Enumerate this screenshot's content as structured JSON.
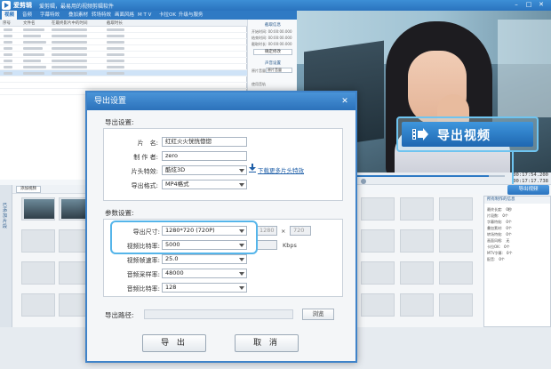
{
  "app": {
    "name": "爱剪辑",
    "subtitle": "爱剪辑，最易用的视频剪辑软件",
    "window_buttons": [
      "–",
      "□",
      "✕"
    ]
  },
  "menu": [
    "视频",
    "音频",
    "字幕特效",
    "叠加素材",
    "转场特效",
    "画面风格",
    "M T V",
    "卡拉OK",
    "升级与服务"
  ],
  "file_panel": {
    "columns": [
      "序号",
      "文件名",
      "在最终影片中的时间",
      "截取时长"
    ]
  },
  "info_panel": {
    "caption1": "截取信息",
    "caption2": "声音设置",
    "kv": [
      "开始时间: 00:00:00.000",
      "结束时间: 00:00:00.000",
      "截取时长: 00:00:00.000"
    ],
    "button": "确定修改",
    "sound_label": "原片音量",
    "sound_value": "原片音量",
    "checkbox_label": "使用音轨"
  },
  "controls": {
    "time_current": "00:17:54.200",
    "time_total": "00:17:17.738",
    "progress": 0.92
  },
  "export_small": "导出视频",
  "callout": {
    "label": "导出视频"
  },
  "bottom": {
    "left_tab": "已添加片段",
    "clip_button": "添加视频"
  },
  "props": {
    "header": "所有制作的信息",
    "rows": [
      {
        "k": "最终长度:",
        "v": "0秒"
      },
      {
        "k": "片段数:",
        "v": "0个"
      },
      {
        "k": "字幕特效:",
        "v": "0个"
      },
      {
        "k": "叠加素材:",
        "v": "0个"
      },
      {
        "k": "转场特效:",
        "v": "0个"
      },
      {
        "k": "画面风格:",
        "v": "无"
      },
      {
        "k": "卡拉OK:",
        "v": "0个"
      },
      {
        "k": "MTV字幕:",
        "v": "0个"
      },
      {
        "k": "配音:",
        "v": "0个"
      }
    ]
  },
  "dialog": {
    "title": "导出设置",
    "close": "✕",
    "export_section": "导出设置:",
    "fields": {
      "title_label": "片　名:",
      "title_value": "红红火火恍恍惚惚",
      "author_label": "制 作 者:",
      "author_value": "zero",
      "intro_label": "片头特效:",
      "intro_value": "酷炫3D",
      "format_label": "导出格式:",
      "format_value": "MP4格式"
    },
    "download_link": "下载更多片头特效",
    "params_section": "参数设置:",
    "params": {
      "size_label": "导出尺寸:",
      "size_value": "1280*720 (720P)",
      "size_w": "1280",
      "size_x": "×",
      "size_h": "720",
      "vbitrate_label": "视频比特率:",
      "vbitrate_value": "5000",
      "vbitrate_unit": "Kbps",
      "fps_label": "视频帧速率:",
      "fps_value": "25.0",
      "sample_label": "音频采样率:",
      "sample_value": "48000",
      "abitrate_label": "音频比特率:",
      "abitrate_value": "128"
    },
    "path_label": "导出路径:",
    "browse": "浏览",
    "export_button": "导 出",
    "cancel_button": "取 消"
  }
}
